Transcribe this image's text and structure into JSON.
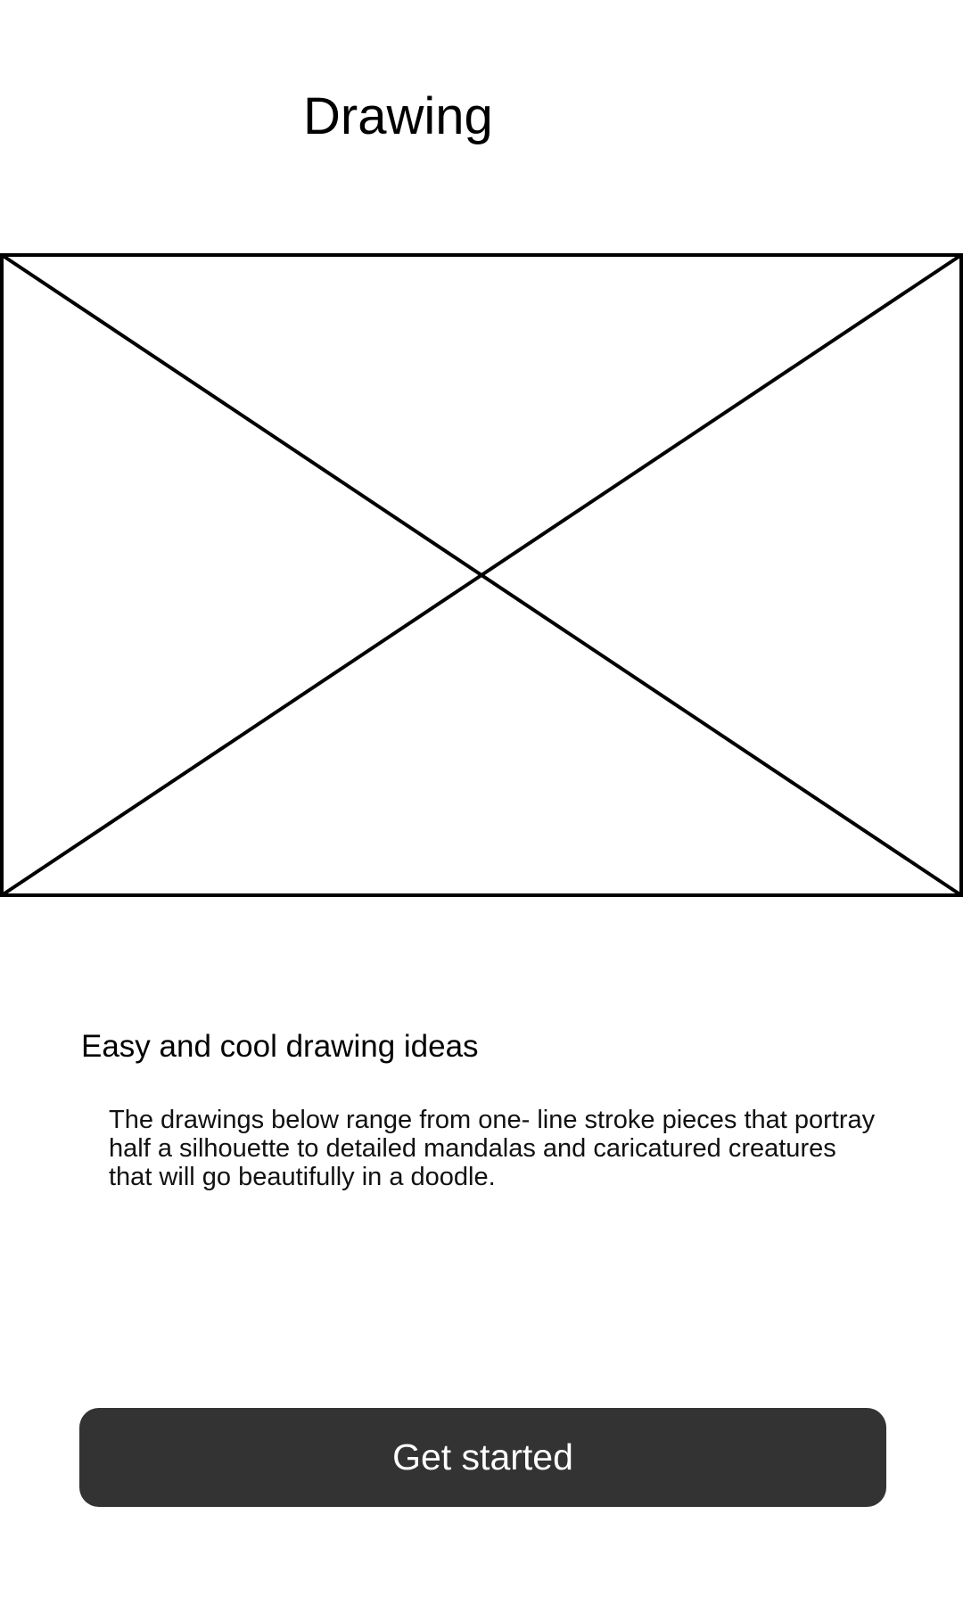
{
  "header": {
    "title": "Drawing"
  },
  "hero": {
    "image_icon": "image-placeholder-icon"
  },
  "content": {
    "heading": "Easy and cool drawing ideas",
    "description": "The drawings below range from one- line stroke pieces that portray half a silhouette to detailed mandalas and caricatured creatures that will go beautifully in a doodle."
  },
  "actions": {
    "primary_label": "Get started"
  },
  "colors": {
    "background": "#ffffff",
    "text": "#000000",
    "button_background": "#333333",
    "button_text": "#ffffff",
    "placeholder_stroke": "#000000"
  }
}
